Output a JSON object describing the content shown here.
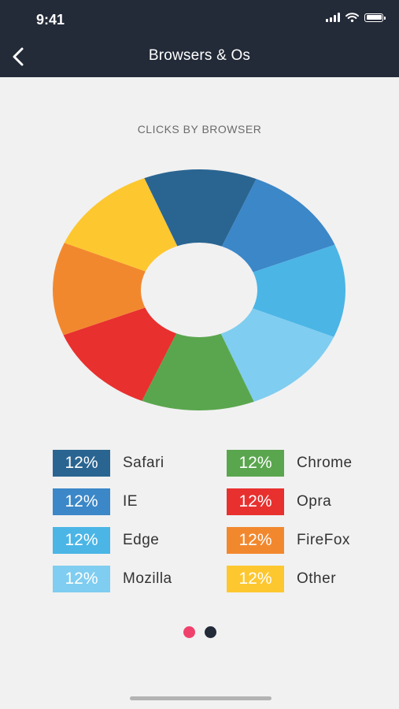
{
  "status_bar": {
    "time": "9:41"
  },
  "header": {
    "title": "Browsers & Os",
    "back_icon": "chevron-left-icon"
  },
  "chart_data": {
    "type": "pie",
    "title": "CLICKS BY BROWSER",
    "slices": [
      {
        "label": "Safari",
        "value": 12,
        "color": "#2a6592"
      },
      {
        "label": "IE",
        "value": 12,
        "color": "#3b87c8"
      },
      {
        "label": "Edge",
        "value": 12,
        "color": "#4bb5e6"
      },
      {
        "label": "Mozilla",
        "value": 12,
        "color": "#7fcdf0"
      },
      {
        "label": "Chrome",
        "value": 12,
        "color": "#5aa64e"
      },
      {
        "label": "Opra",
        "value": 12,
        "color": "#e8302f"
      },
      {
        "label": "FireFox",
        "value": 12,
        "color": "#f2882e"
      },
      {
        "label": "Other",
        "value": 12,
        "color": "#fdc730"
      }
    ]
  },
  "legend": [
    {
      "value": "12%",
      "label": "Safari",
      "color": "#2a6592"
    },
    {
      "value": "12%",
      "label": "IE",
      "color": "#3b87c8"
    },
    {
      "value": "12%",
      "label": "Edge",
      "color": "#4bb5e6"
    },
    {
      "value": "12%",
      "label": "Mozilla",
      "color": "#7fcdf0"
    },
    {
      "value": "12%",
      "label": "Chrome",
      "color": "#5aa64e"
    },
    {
      "value": "12%",
      "label": "Opra",
      "color": "#e8302f"
    },
    {
      "value": "12%",
      "label": "FireFox",
      "color": "#f2882e"
    },
    {
      "value": "12%",
      "label": "Other",
      "color": "#fdc730"
    }
  ],
  "pager": {
    "total": 2,
    "active": 0,
    "active_color": "#f0416c",
    "inactive_color": "#232a38"
  }
}
